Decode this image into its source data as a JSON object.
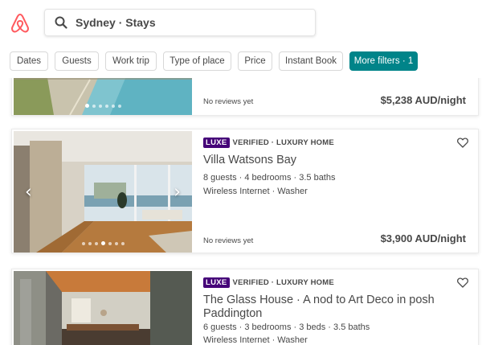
{
  "search": {
    "text": "Sydney · Stays"
  },
  "filters": [
    {
      "label": "Dates"
    },
    {
      "label": "Guests"
    },
    {
      "label": "Work trip"
    },
    {
      "label": "Type of place"
    },
    {
      "label": "Price"
    },
    {
      "label": "Instant Book"
    },
    {
      "label": "More filters · 1",
      "active": true
    }
  ],
  "listings": [
    {
      "reviews": "No reviews yet",
      "price": "$5,238 AUD/night"
    },
    {
      "badge": "LUXE",
      "tag": "VERIFIED · LUXURY HOME",
      "title": "Villa Watsons Bay",
      "details": "8 guests · 4 bedrooms · 3.5 baths",
      "amenities": "Wireless Internet · Washer",
      "reviews": "No reviews yet",
      "price": "$3,900 AUD/night"
    },
    {
      "badge": "LUXE",
      "tag": "VERIFIED · LUXURY HOME",
      "title": "The Glass House · A nod to Art Deco in posh Paddington",
      "details": "6 guests · 3 bedrooms · 3 beds · 3.5 baths",
      "amenities": "Wireless Internet · Washer"
    }
  ],
  "colors": {
    "brand": "#FF5A5F",
    "accent": "#008489",
    "luxe": "#460479"
  },
  "icons": {
    "logo": "airbnb-logo",
    "search": "search-icon",
    "save": "heart-icon",
    "prev": "chevron-left-icon",
    "next": "chevron-right-icon"
  }
}
